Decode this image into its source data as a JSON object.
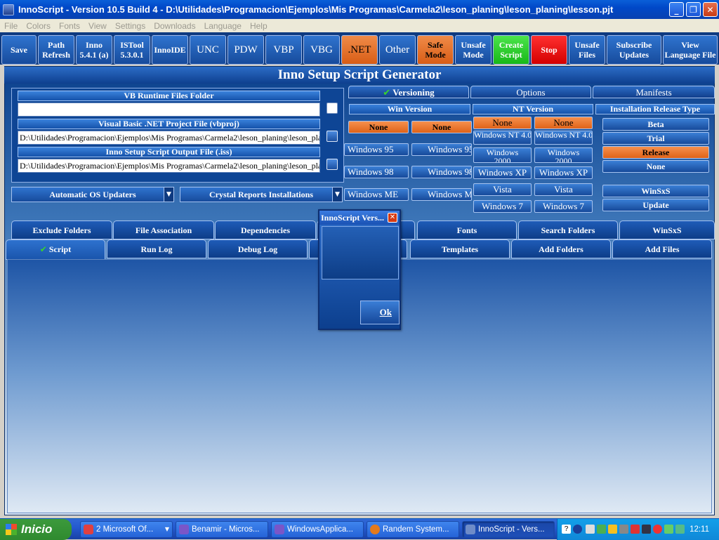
{
  "window": {
    "title": "InnoScript - Version 10.5  Build 4 - D:\\Utilidades\\Programacion\\Ejemplos\\Mis Programas\\Carmela2\\leson_planing\\leson_planing\\lesson.pjt",
    "minimize": "_",
    "restore": "❐",
    "close": "✕"
  },
  "menu": [
    "File",
    "Colors",
    "Fonts",
    "View",
    "Settings",
    "Downloads",
    "Language",
    "Help"
  ],
  "toolbar": {
    "save": "Save",
    "path_refresh": "Path Refresh",
    "inno": "Inno 5.4.1 (a)",
    "istool": "ISTool 5.3.0.1",
    "innoide": "InnoIDE",
    "unc": "UNC",
    "pdw": "PDW",
    "vbp": "VBP",
    "vbg": "VBG",
    "net": ".NET",
    "other": "Other",
    "safe_mode": "Safe Mode",
    "unsafe_mode": "Unsafe Mode",
    "create_script": "Create Script",
    "stop": "Stop",
    "unsafe_files": "Unsafe Files",
    "subscribe_updates": "Subscribe Updates",
    "view_language_file": "View Language File"
  },
  "generator": {
    "title": "Inno Setup Script Generator",
    "vb_runtime_header": "VB Runtime Files Folder",
    "vb_runtime_value": "",
    "vbnet_header": "Visual Basic .NET Project File (vbproj)",
    "vbnet_value": "D:\\Utilidades\\Programacion\\Ejemplos\\Mis Programas\\Carmela2\\leson_planing\\leson_planing\\",
    "output_header": "Inno Setup Script Output File (.iss)",
    "output_value": "D:\\Utilidades\\Programacion\\Ejemplos\\Mis Programas\\Carmela2\\leson_planing\\leson_planing\\",
    "auto_os_updaters": "Automatic OS Updaters",
    "crystal_reports": "Crystal Reports Installations"
  },
  "right_tabs": {
    "versioning": "Versioning",
    "options": "Options",
    "manifests": "Manifests"
  },
  "versioning": {
    "win_version_header": "Win Version",
    "nt_version_header": "NT Version",
    "release_type_header": "Installation Release Type",
    "win_rows": [
      [
        "None",
        "None"
      ],
      [
        "Windows 95",
        "Windows 95"
      ],
      [
        "Windows 98",
        "Windows 98"
      ],
      [
        "Windows ME",
        "Windows ME"
      ]
    ],
    "nt_rows": [
      [
        "None",
        "None"
      ],
      [
        "Windows NT 4.0",
        "Windows NT 4.0"
      ],
      [
        "Windows 2000",
        "Windows 2000"
      ],
      [
        "Windows XP",
        "Windows XP"
      ],
      [
        "Vista",
        "Vista"
      ],
      [
        "Windows 7",
        "Windows 7"
      ]
    ],
    "release": [
      "Beta",
      "Trial",
      "Release",
      "None"
    ],
    "winsxs": "WinSxS",
    "update": "Update"
  },
  "bottom_tabs_row1": [
    "Exclude Folders",
    "File Association",
    "Dependencies",
    "",
    "Fonts",
    "Search Folders",
    "WinSxS"
  ],
  "bottom_tabs_row2": [
    "Script",
    "Run Log",
    "Debug Log",
    "",
    "Templates",
    "Add Folders",
    "Add Files"
  ],
  "dialog": {
    "title": "InnoScript Vers...",
    "close": "✕",
    "ok": "Ok"
  },
  "taskbar": {
    "start": "Inicio",
    "tasks": [
      {
        "label": "2 Microsoft Of...",
        "color": "#e04040"
      },
      {
        "label": "Benamir - Micros...",
        "color": "#7a56c8"
      },
      {
        "label": "WindowsApplica...",
        "color": "#7a56c8"
      },
      {
        "label": "Randem System...",
        "color": "#e47a1c"
      },
      {
        "label": "InnoScript - Vers...",
        "color": "#6e8cc8"
      }
    ],
    "clock": "12:11"
  }
}
